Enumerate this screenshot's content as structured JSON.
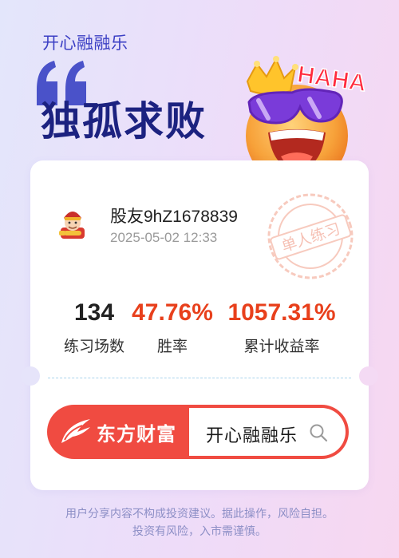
{
  "header": {
    "app_name": "开心融融乐",
    "title": "独孤求败",
    "emoji_text": "HAHA",
    "colors": {
      "title": "#1c2280",
      "app_name": "#3b3fc4"
    }
  },
  "user": {
    "name": "股友9hZ1678839",
    "timestamp": "2025-05-02 12:33",
    "stamp_text": "单人练习"
  },
  "stats": [
    {
      "value": "134",
      "label": "练习场数",
      "color": "#222222"
    },
    {
      "value": "47.76%",
      "label": "胜率",
      "color": "#e8401c"
    },
    {
      "value": "1057.31%",
      "label": "累计收益率",
      "color": "#e8401c"
    }
  ],
  "brand": {
    "name": "东方财富",
    "search_text": "开心融融乐",
    "color": "#f04b41"
  },
  "disclaimer": {
    "line1": "用户分享内容不构成投资建议。据此操作，风险自担。",
    "line2": "投资有风险，入市需谨慎。"
  }
}
